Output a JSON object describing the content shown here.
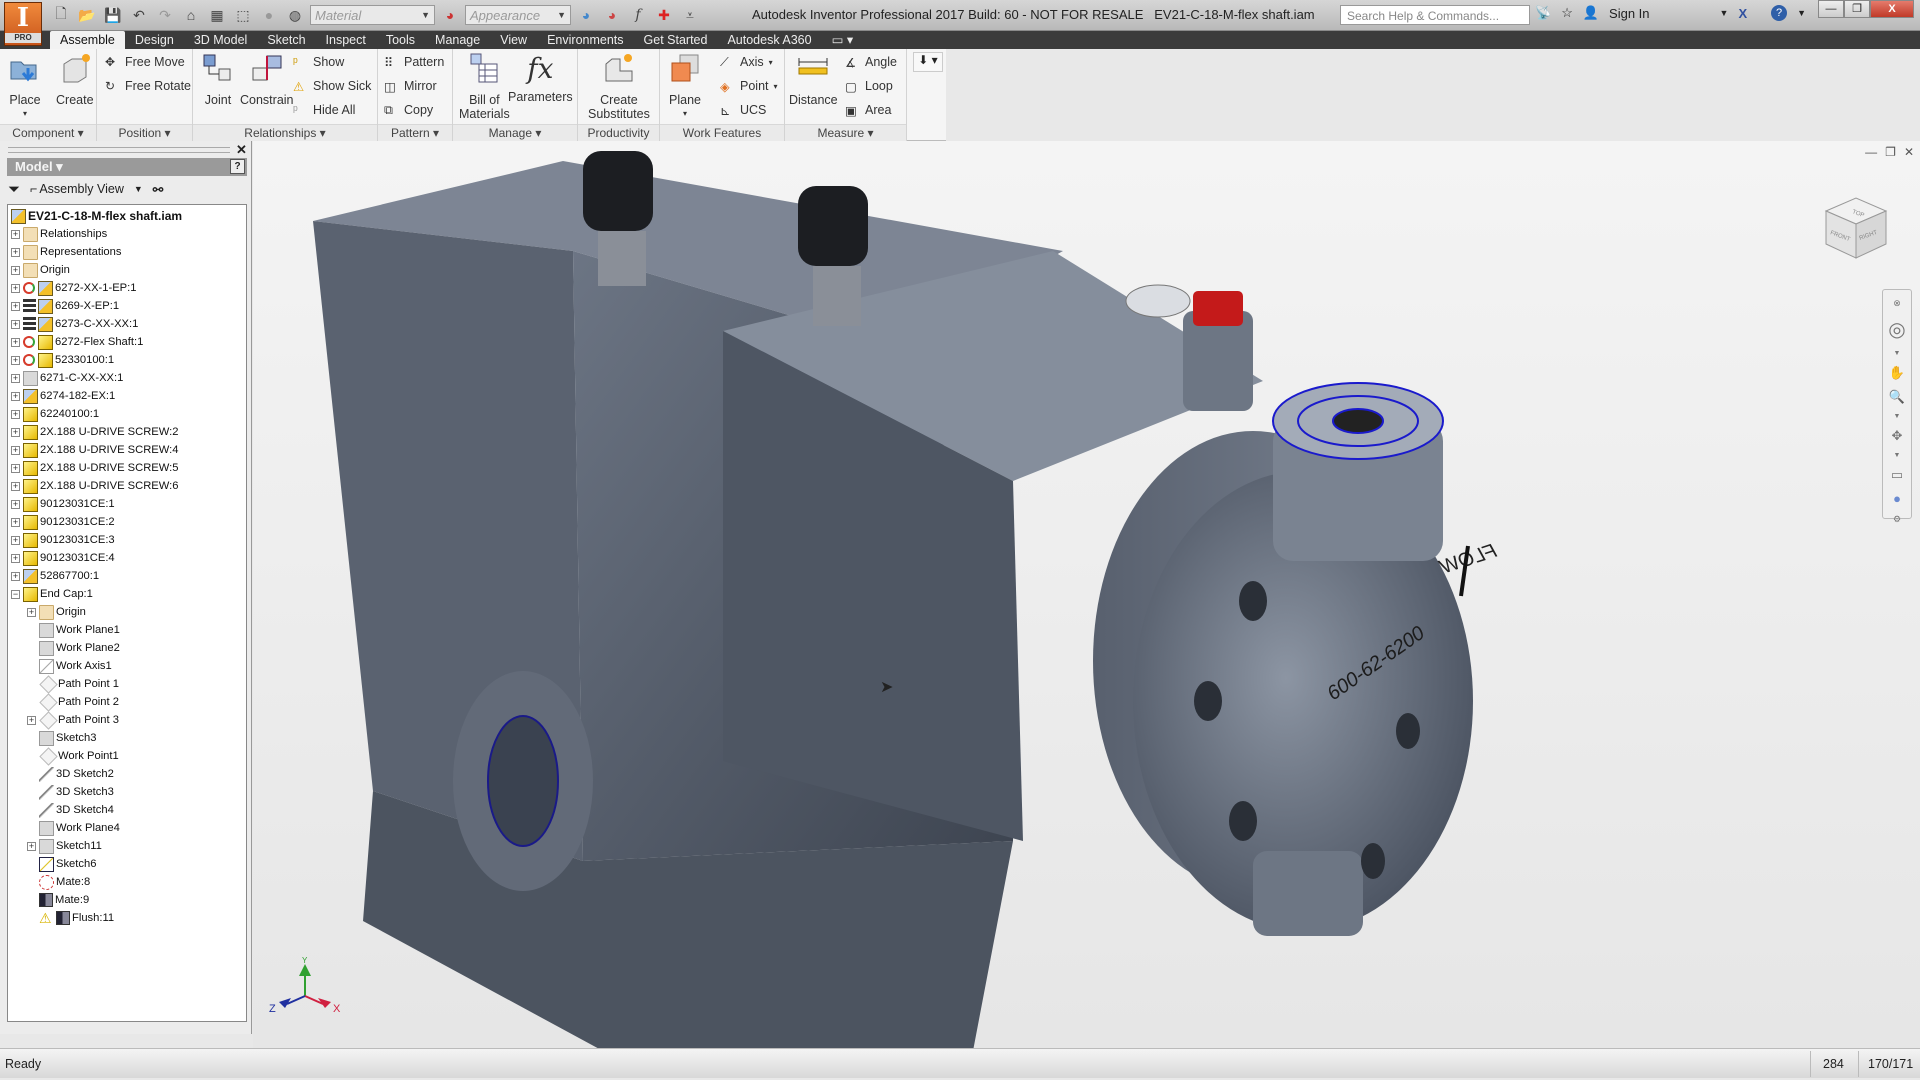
{
  "app": {
    "logo_letter": "I",
    "logo_badge": "PRO",
    "title": "Autodesk Inventor Professional 2017 Build: 60 - NOT FOR RESALE",
    "document": "EV21-C-18-M-flex shaft.iam"
  },
  "quick_access": {
    "icons": [
      "new-icon",
      "open-icon",
      "save-icon",
      "undo-icon",
      "redo-icon",
      "home-icon",
      "view-icon",
      "select-icon",
      "color-icon",
      "material-globe-icon"
    ],
    "material_placeholder": "Material",
    "appearance_placeholder": "Appearance",
    "trailing_icons": [
      "appearance-override-icon",
      "clear-appearance-icon",
      "fx-icon",
      "measure-crosshair-icon",
      "customize-icon"
    ]
  },
  "help": {
    "search_placeholder": "Search Help & Commands...",
    "sign_in": "Sign In"
  },
  "window_buttons": {
    "minimize": "—",
    "restore": "❐",
    "close": "X"
  },
  "tabs": [
    "Assemble",
    "Design",
    "3D Model",
    "Sketch",
    "Inspect",
    "Tools",
    "Manage",
    "View",
    "Environments",
    "Get Started",
    "Autodesk A360"
  ],
  "active_tab": "Assemble",
  "ribbon": {
    "component": {
      "title": "Component",
      "place": "Place",
      "create": "Create"
    },
    "position": {
      "title": "Position",
      "free_move": "Free Move",
      "free_rotate": "Free Rotate"
    },
    "relationships": {
      "title": "Relationships",
      "joint": "Joint",
      "constrain": "Constrain",
      "show": "Show",
      "show_sick": "Show Sick",
      "hide_all": "Hide All"
    },
    "pattern": {
      "title": "Pattern",
      "pattern": "Pattern",
      "mirror": "Mirror",
      "copy": "Copy"
    },
    "manage": {
      "title": "Manage",
      "bom_line1": "Bill of",
      "bom_line2": "Materials",
      "parameters": "Parameters"
    },
    "productivity": {
      "title": "Productivity",
      "line1": "Create",
      "line2": "Substitutes"
    },
    "work_features": {
      "title": "Work Features",
      "plane": "Plane",
      "axis": "Axis",
      "point": "Point",
      "ucs": "UCS"
    },
    "measure": {
      "title": "Measure",
      "distance": "Distance",
      "angle": "Angle",
      "loop": "Loop",
      "area": "Area"
    }
  },
  "browser": {
    "header": "Model",
    "view_label": "Assembly View",
    "root": "EV21-C-18-M-flex shaft.iam",
    "nodes": [
      {
        "label": "Relationships",
        "icon": "folder",
        "exp": true
      },
      {
        "label": "Representations",
        "icon": "representations",
        "exp": true
      },
      {
        "label": "Origin",
        "icon": "folder",
        "exp": true
      },
      {
        "label": "6272-XX-1-EP:1",
        "icon": "asm-update",
        "exp": true
      },
      {
        "label": "6269-X-EP:1",
        "icon": "asm-grounded",
        "exp": true
      },
      {
        "label": "6273-C-XX-XX:1",
        "icon": "asm-grounded",
        "exp": true
      },
      {
        "label": "6272-Flex Shaft:1",
        "icon": "part-update",
        "exp": true
      },
      {
        "label": "52330100:1",
        "icon": "part-update",
        "exp": true
      },
      {
        "label": "6271-C-XX-XX:1",
        "icon": "grey",
        "exp": true
      },
      {
        "label": "6274-182-EX:1",
        "icon": "asm",
        "exp": true
      },
      {
        "label": "62240100:1",
        "icon": "part",
        "exp": true
      },
      {
        "label": "2X.188 U-DRIVE SCREW:2",
        "icon": "part",
        "exp": true
      },
      {
        "label": "2X.188 U-DRIVE SCREW:4",
        "icon": "part",
        "exp": true
      },
      {
        "label": "2X.188 U-DRIVE SCREW:5",
        "icon": "part",
        "exp": true
      },
      {
        "label": "2X.188 U-DRIVE SCREW:6",
        "icon": "part",
        "exp": true
      },
      {
        "label": "90123031CE:1",
        "icon": "part",
        "exp": true
      },
      {
        "label": "90123031CE:2",
        "icon": "part",
        "exp": true
      },
      {
        "label": "90123031CE:3",
        "icon": "part",
        "exp": true
      },
      {
        "label": "90123031CE:4",
        "icon": "part",
        "exp": true
      },
      {
        "label": "52867700:1",
        "icon": "asm",
        "exp": true
      },
      {
        "label": "End Cap:1",
        "icon": "part",
        "exp": "open"
      },
      {
        "label": "Origin",
        "icon": "folder",
        "exp": true,
        "child": true
      },
      {
        "label": "Work Plane1",
        "icon": "plane",
        "child": true
      },
      {
        "label": "Work Plane2",
        "icon": "plane",
        "child": true
      },
      {
        "label": "Work Axis1",
        "icon": "axis",
        "child": true
      },
      {
        "label": "Path Point 1",
        "icon": "point",
        "child": true
      },
      {
        "label": "Path Point 2",
        "icon": "point",
        "child": true
      },
      {
        "label": "Path Point 3",
        "icon": "point",
        "exp": true,
        "child": true
      },
      {
        "label": "Sketch3",
        "icon": "sketch",
        "child": true
      },
      {
        "label": "Work Point1",
        "icon": "point",
        "child": true
      },
      {
        "label": "3D Sketch2",
        "icon": "sketch3d",
        "child": true
      },
      {
        "label": "3D Sketch3",
        "icon": "sketch3d",
        "child": true
      },
      {
        "label": "3D Sketch4",
        "icon": "sketch3d",
        "child": true
      },
      {
        "label": "Work Plane4",
        "icon": "plane",
        "child": true
      },
      {
        "label": "Sketch11",
        "icon": "sketch",
        "exp": true,
        "child": true
      },
      {
        "label": "Sketch6",
        "icon": "sketch-active",
        "child": true
      },
      {
        "label": "Mate:8",
        "icon": "mate",
        "child": true
      },
      {
        "label": "Mate:9",
        "icon": "constraint",
        "child": true
      },
      {
        "label": "Flush:11",
        "icon": "warning-flush",
        "child": true
      }
    ]
  },
  "viewport": {
    "viewcube": {
      "top": "TOP",
      "front": "FRONT",
      "right": "RIGHT"
    },
    "model_text": {
      "part_number": "600-62-6200",
      "flow": "FLOW"
    },
    "triad": {
      "x": "X",
      "y": "Y",
      "z": "Z"
    },
    "colors": {
      "x": "#d02040",
      "y": "#30a030",
      "z": "#2030a0",
      "selection": "#1a1acc"
    }
  },
  "status": {
    "text": "Ready",
    "count": "284",
    "ratio": "170/171"
  }
}
